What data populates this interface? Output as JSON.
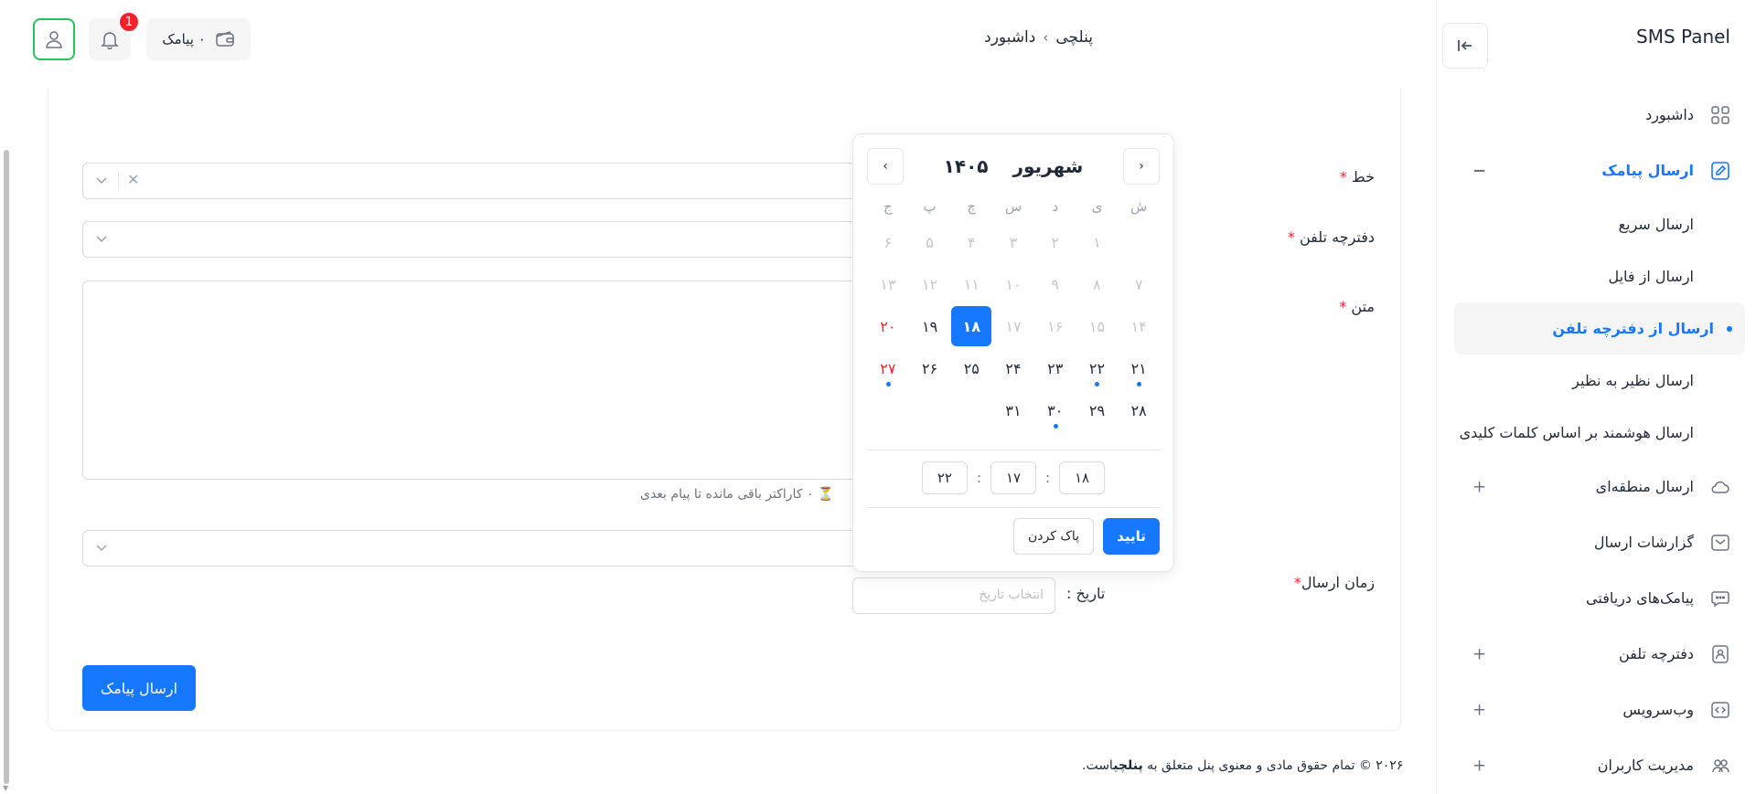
{
  "brand": "SMS Panel",
  "header": {
    "breadcrumb": [
      "پنلچی",
      "داشبورد"
    ],
    "credit_label": "۰ پیامک",
    "notif_count": "1"
  },
  "sidebar": {
    "items": [
      {
        "label": "داشبورد",
        "icon": "grid-icon"
      },
      {
        "label": "ارسال پیامک",
        "icon": "edit-icon",
        "active": true,
        "expander": "−"
      },
      {
        "label": "ارسال منطقه‌ای",
        "icon": "cloud-icon",
        "expander": "+"
      },
      {
        "label": "گزارشات ارسال",
        "icon": "mail-icon"
      },
      {
        "label": "پیامک‌های دریافتی",
        "icon": "chat-icon"
      },
      {
        "label": "دفترچه تلفن",
        "icon": "contact-book-icon",
        "expander": "+"
      },
      {
        "label": "وب‌سرویس",
        "icon": "code-icon",
        "expander": "+"
      },
      {
        "label": "مدیریت کاربران",
        "icon": "users-icon",
        "expander": "+"
      }
    ],
    "sub_items": [
      {
        "label": "ارسال سریع"
      },
      {
        "label": "ارسال از فایل"
      },
      {
        "label": "ارسال از دفترچه تلفن",
        "selected": true
      },
      {
        "label": "ارسال نظیر به نظیر"
      },
      {
        "label": "ارسال هوشمند بر اساس کلمات کلیدی"
      }
    ]
  },
  "form": {
    "line_label": "خط",
    "phonebook_label": "دفترچه تلفن",
    "text_label": "متن",
    "counter": "۰ کاراکتر باقی مانده تا پیام بعدی",
    "send_time_label": "زمان ارسال",
    "date_label": "تاریخ :",
    "date_placeholder": "انتخاب تاریخ",
    "submit": "ارسال پیامک",
    "req_mark": "*"
  },
  "calendar": {
    "month": "شهریور",
    "year": "۱۴۰۵",
    "prev_glyph": "‹",
    "next_glyph": "›",
    "weekdays": [
      "ش",
      "ی",
      "د",
      "س",
      "چ",
      "پ",
      "ج"
    ],
    "weeks": [
      [
        {
          "d": ""
        },
        {
          "d": "۱",
          "m": true
        },
        {
          "d": "۲",
          "m": true
        },
        {
          "d": "۳",
          "m": true
        },
        {
          "d": "۴",
          "m": true
        },
        {
          "d": "۵",
          "m": true
        },
        {
          "d": "۶",
          "m": true
        }
      ],
      [
        {
          "d": "۷",
          "m": true
        },
        {
          "d": "۸",
          "m": true
        },
        {
          "d": "۹",
          "m": true
        },
        {
          "d": "۱۰",
          "m": true
        },
        {
          "d": "۱۱",
          "m": true
        },
        {
          "d": "۱۲",
          "m": true
        },
        {
          "d": "۱۳",
          "m": true
        }
      ],
      [
        {
          "d": "۱۴",
          "m": true
        },
        {
          "d": "۱۵",
          "m": true
        },
        {
          "d": "۱۶",
          "m": true
        },
        {
          "d": "۱۷",
          "m": true
        },
        {
          "d": "۱۸",
          "today": true
        },
        {
          "d": "۱۹"
        },
        {
          "d": "۲۰",
          "h": true
        }
      ],
      [
        {
          "d": "۲۱",
          "e": true
        },
        {
          "d": "۲۲",
          "e": true
        },
        {
          "d": "۲۳"
        },
        {
          "d": "۲۴"
        },
        {
          "d": "۲۵"
        },
        {
          "d": "۲۶"
        },
        {
          "d": "۲۷",
          "h": true,
          "e": true
        }
      ],
      [
        {
          "d": "۲۸"
        },
        {
          "d": "۲۹"
        },
        {
          "d": "۳۰",
          "e": true
        },
        {
          "d": "۳۱"
        },
        {
          "d": ""
        },
        {
          "d": ""
        },
        {
          "d": ""
        }
      ]
    ],
    "time": {
      "hour": "۱۸",
      "minute": "۱۷",
      "second": "۲۲",
      "sep": ":"
    },
    "confirm": "تایید",
    "clear": "پاک کردن"
  },
  "footer": {
    "prefix": "۲۰۲۶ © تمام حقوق مادی و معنوی پنل متعلق به",
    "brand": "پنلچی",
    "suffix": "است."
  },
  "colors": {
    "primary": "#1677ff",
    "danger": "#f5222d",
    "success": "#22c55e"
  }
}
